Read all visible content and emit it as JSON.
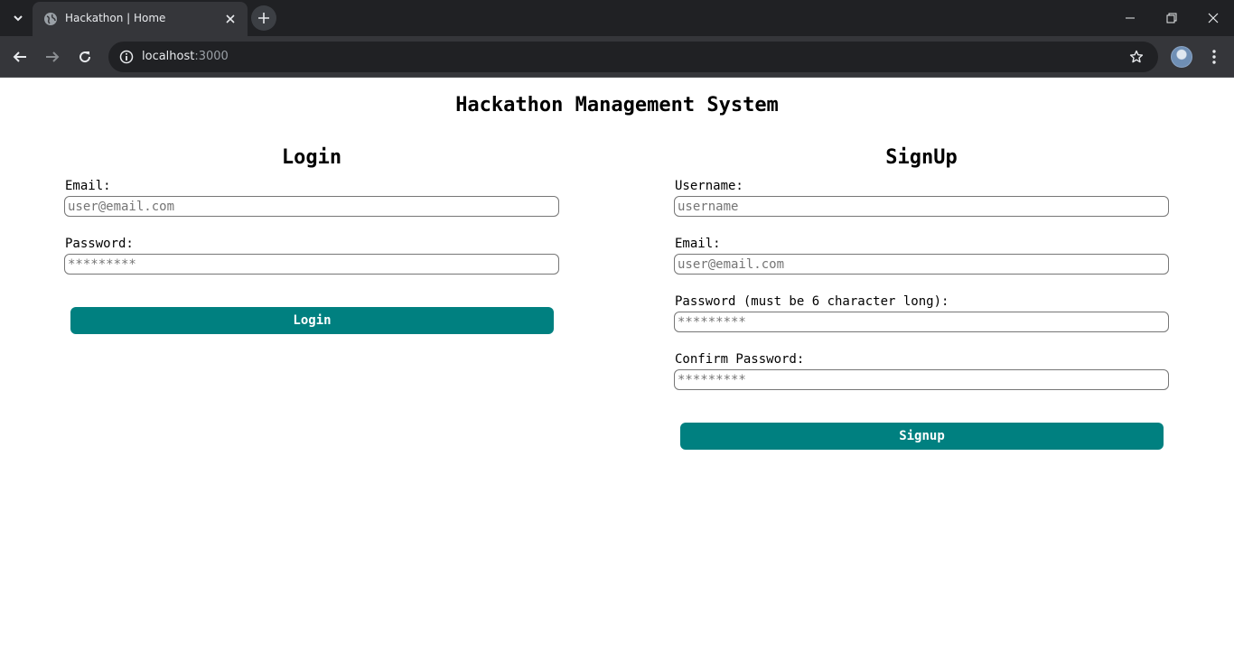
{
  "browser": {
    "tab_title": "Hackathon | Home",
    "url_host": "localhost",
    "url_port": ":3000"
  },
  "page": {
    "title": "Hackathon Management System",
    "login": {
      "heading": "Login",
      "email_label": "Email:",
      "email_placeholder": "user@email.com",
      "password_label": "Password:",
      "password_placeholder": "*********",
      "button": "Login"
    },
    "signup": {
      "heading": "SignUp",
      "username_label": "Username:",
      "username_placeholder": "username",
      "email_label": "Email:",
      "email_placeholder": "user@email.com",
      "password_label": "Password (must be 6 character long):",
      "password_placeholder": "*********",
      "confirm_label": "Confirm Password:",
      "confirm_placeholder": "*********",
      "button": "Signup"
    }
  },
  "colors": {
    "button": "#008080",
    "chrome_dark": "#202124",
    "chrome_toolbar": "#35363a"
  }
}
